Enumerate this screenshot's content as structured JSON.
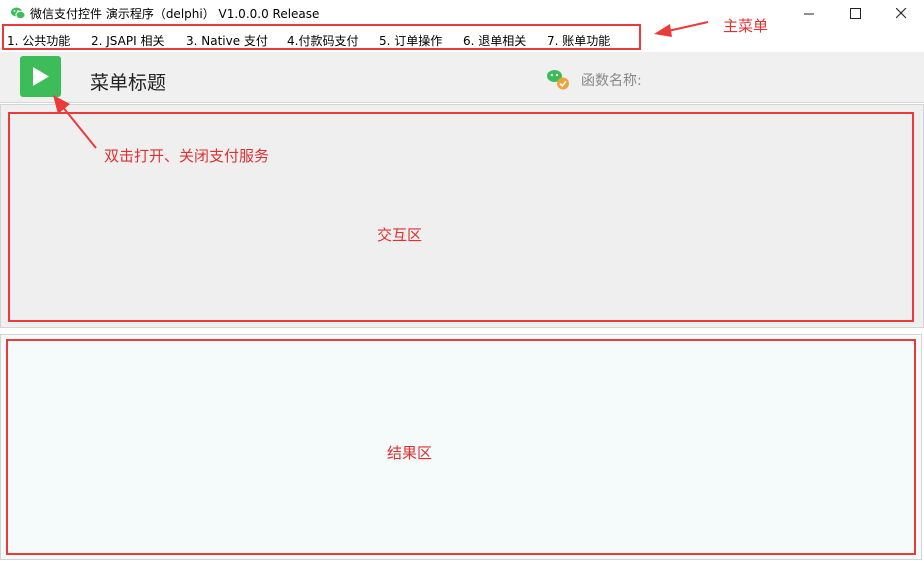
{
  "window": {
    "title": "微信支付控件 演示程序（delphi） V1.0.0.0  Release",
    "icon": "wechat-icon",
    "controls": [
      "minimize-icon",
      "maximize-icon",
      "close-icon"
    ]
  },
  "menu": {
    "items": [
      {
        "label": "1. 公共功能"
      },
      {
        "label": "2. JSAPI 相关"
      },
      {
        "label": "3. Native 支付"
      },
      {
        "label": "4.付款码支付"
      },
      {
        "label": "5. 订单操作"
      },
      {
        "label": "6. 退单相关"
      },
      {
        "label": "7. 账单功能"
      }
    ]
  },
  "header": {
    "play_icon": "play-icon",
    "title": "菜单标题",
    "badge_icon": "wechat-check-icon",
    "func_name_label": "函数名称:"
  },
  "annotations": {
    "main_menu": "主菜单",
    "play_hint": "双击打开、关闭支付服务",
    "interact_area": "交互区",
    "result_area": "结果区"
  },
  "colors": {
    "annotation_red": "#ea3a3a",
    "play_green": "#3dbd5a",
    "result_bg": "#f4fbfa",
    "interact_bg": "#efefef"
  }
}
